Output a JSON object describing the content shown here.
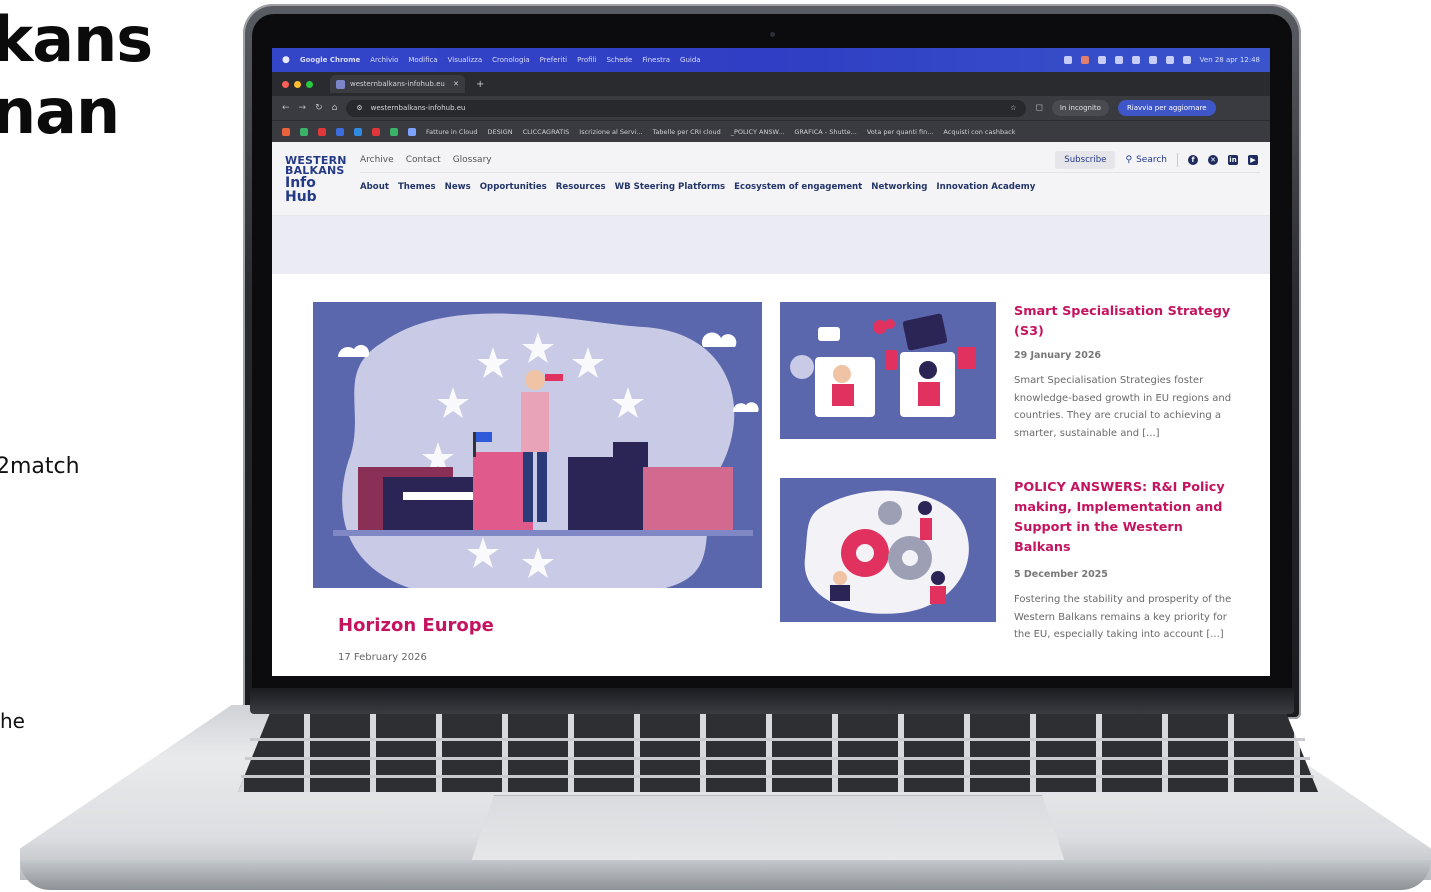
{
  "slide": {
    "title_line1": "kans",
    "title_line2": "nan",
    "snippet1": "2match",
    "snippet2": "he"
  },
  "menubar": {
    "app": "Google Chrome",
    "items": [
      "Archivio",
      "Modifica",
      "Visualizza",
      "Cronologia",
      "Preferiti",
      "Profili",
      "Schede",
      "Finestra",
      "Guida"
    ],
    "clock": "Ven 28 apr 12:48"
  },
  "browser": {
    "tab_title": "westernbalkans-infohub.eu",
    "url": "westernbalkans-infohub.eu",
    "incognito_label": "In incognito",
    "update_label": "Riavvia per aggiornare",
    "bookmarks": [
      "Fatture in Cloud",
      "DESIGN",
      "CLICCAGRATIS",
      "Iscrizione al Servi...",
      "Tabelle per CRI cloud",
      "_POLICY ANSW...",
      "GRAFICA - Shutte...",
      "Vota per quanti fin...",
      "Acquisti con cashback"
    ]
  },
  "site": {
    "logo": {
      "line1": "WESTERN",
      "line2": "BALKANS",
      "line3": "Info Hub"
    },
    "top_nav": [
      "Archive",
      "Contact",
      "Glossary"
    ],
    "main_nav": [
      "About",
      "Themes",
      "News",
      "Opportunities",
      "Resources",
      "WB Steering Platforms",
      "Ecosystem of engagement",
      "Networking",
      "Innovation Academy"
    ],
    "subscribe_label": "Subscribe",
    "search_label": "Search",
    "social_icons": [
      "facebook-icon",
      "x-icon",
      "linkedin-icon",
      "youtube-icon"
    ]
  },
  "articles": {
    "main": {
      "title": "Horizon Europe",
      "date": "17 February 2026"
    },
    "cards": [
      {
        "title": "Smart Specialisation Strategy (S3)",
        "date": "29 January 2026",
        "excerpt": "Smart Specialisation Strategies foster knowledge-based growth in EU regions and countries. They are crucial to achieving a smarter, sustainable and [...]"
      },
      {
        "title": "POLICY ANSWERS: R&I Policy making, Implementation and Support in the Western Balkans",
        "date": "5 December 2025",
        "excerpt": "Fostering the stability and prosperity of the Western Balkans remains a key priority for the EU, especially taking into account [...]"
      }
    ]
  },
  "colors": {
    "accent": "#c4145f",
    "brand_navy": "#253a86",
    "illustration_bg": "#5b67ad",
    "menubar": "#3346c8"
  }
}
